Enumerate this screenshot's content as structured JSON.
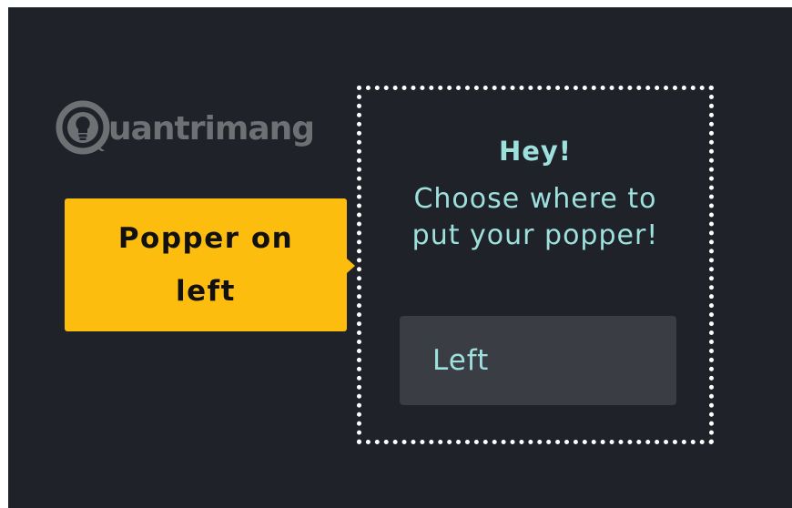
{
  "watermark": {
    "brand": "uantrimang"
  },
  "popper": {
    "label": "Popper on left"
  },
  "reference": {
    "title": "Hey!",
    "message": "Choose where to put your popper!",
    "select": {
      "value": "Left"
    }
  },
  "colors": {
    "background": "#1f2228",
    "popper": "#fdbd0f",
    "text_accent": "#9ee0dd",
    "select_bg": "#3a3d44",
    "logo": "#6e7074"
  },
  "icons": {
    "logo": "lightbulb-icon",
    "arrow": "popper-arrow-right"
  }
}
